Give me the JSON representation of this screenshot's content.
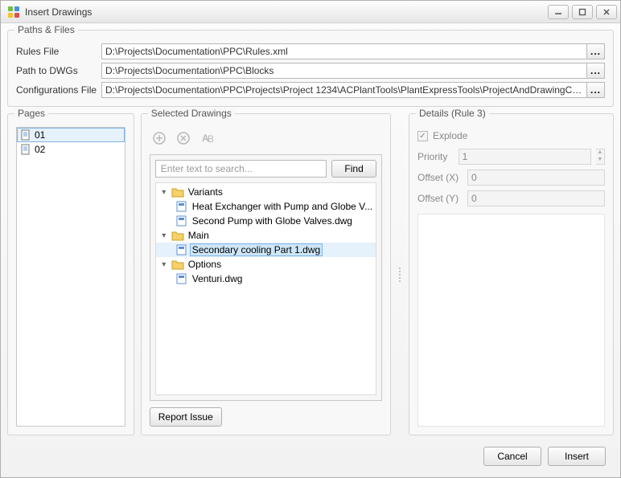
{
  "window": {
    "title": "Insert Drawings"
  },
  "groups": {
    "paths": "Paths & Files",
    "pages": "Pages",
    "selected": "Selected Drawings",
    "details": "Details (Rule 3)"
  },
  "paths": {
    "rules_label": "Rules File",
    "rules_value": "D:\\Projects\\Documentation\\PPC\\Rules.xml",
    "dwgs_label": "Path to DWGs",
    "dwgs_value": "D:\\Projects\\Documentation\\PPC\\Blocks",
    "config_label": "Configurations File",
    "config_value": "D:\\Projects\\Documentation\\PPC\\Projects\\Project 1234\\ACPlantTools\\PlantExpressTools\\ProjectAndDrawingCreate\\ProjectCo",
    "ellipsis": "..."
  },
  "pages": {
    "items": [
      "01",
      "02"
    ],
    "selected_index": 0
  },
  "selected_drawings": {
    "search_placeholder": "Enter text to search...",
    "find_label": "Find",
    "report_label": "Report Issue",
    "tree": {
      "variants": {
        "label": "Variants",
        "children": [
          "Heat Exchanger with Pump and Globe V...",
          "Second Pump with Globe Valves.dwg"
        ]
      },
      "main": {
        "label": "Main",
        "children": [
          "Secondary cooling Part 1.dwg"
        ]
      },
      "options": {
        "label": "Options",
        "children": [
          "Venturi.dwg"
        ]
      }
    },
    "selected_path": "main.0"
  },
  "details": {
    "explode_label": "Explode",
    "explode_checked": true,
    "priority_label": "Priority",
    "priority_value": "1",
    "offsetx_label": "Offset (X)",
    "offsetx_value": "0",
    "offsety_label": "Offset (Y)",
    "offsety_value": "0"
  },
  "footer": {
    "cancel": "Cancel",
    "insert": "Insert"
  }
}
